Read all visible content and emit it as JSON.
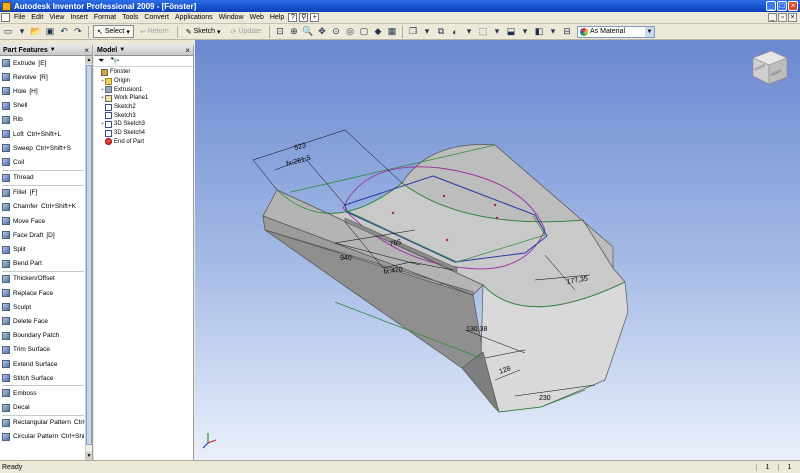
{
  "window": {
    "title": "Autodesk Inventor Professional 2009 - [Fönster]"
  },
  "menu": [
    "File",
    "Edit",
    "View",
    "Insert",
    "Format",
    "Tools",
    "Convert",
    "Applications",
    "Window",
    "Web",
    "Help"
  ],
  "toolbar": {
    "select": "Select",
    "return": "Return",
    "sketch": "Sketch",
    "update": "Update",
    "material": "As Material"
  },
  "features_panel": {
    "title": "Part Features",
    "items": [
      {
        "label": "Extrude",
        "shortcut": "[E]"
      },
      {
        "label": "Revolve",
        "shortcut": "[R]"
      },
      {
        "label": "Hole",
        "shortcut": "[H]"
      },
      {
        "label": "Shell",
        "shortcut": ""
      },
      {
        "label": "Rib",
        "shortcut": ""
      },
      {
        "label": "Loft",
        "shortcut": "Ctrl+Shift+L"
      },
      {
        "label": "Sweep",
        "shortcut": "Ctrl+Shift+S"
      },
      {
        "label": "Coil",
        "shortcut": ""
      },
      {
        "label": "Thread",
        "shortcut": ""
      },
      {
        "label": "Fillet",
        "shortcut": "[F]"
      },
      {
        "label": "Chamfer",
        "shortcut": "Ctrl+Shift+K"
      },
      {
        "label": "Move Face",
        "shortcut": ""
      },
      {
        "label": "Face Draft",
        "shortcut": "[D]"
      },
      {
        "label": "Split",
        "shortcut": ""
      },
      {
        "label": "Bend Part",
        "shortcut": ""
      },
      {
        "label": "Thicken/Offset",
        "shortcut": ""
      },
      {
        "label": "Replace Face",
        "shortcut": ""
      },
      {
        "label": "Sculpt",
        "shortcut": ""
      },
      {
        "label": "Delete Face",
        "shortcut": ""
      },
      {
        "label": "Boundary Patch",
        "shortcut": ""
      },
      {
        "label": "Trim Surface",
        "shortcut": ""
      },
      {
        "label": "Extend Surface",
        "shortcut": ""
      },
      {
        "label": "Stitch Surface",
        "shortcut": ""
      },
      {
        "label": "Emboss",
        "shortcut": ""
      },
      {
        "label": "Decal",
        "shortcut": ""
      },
      {
        "label": "Rectangular Pattern",
        "shortcut": "Ctrl+Shift+R"
      },
      {
        "label": "Circular Pattern",
        "shortcut": "Ctrl+Shift+O"
      }
    ]
  },
  "model_panel": {
    "title": "Model",
    "tree": [
      {
        "label": "Fönster",
        "level": 0,
        "icon": "part",
        "expander": ""
      },
      {
        "label": "Origin",
        "level": 1,
        "icon": "folder",
        "expander": "+"
      },
      {
        "label": "Extrusion1",
        "level": 1,
        "icon": "extr",
        "expander": "+"
      },
      {
        "label": "Work Plane1",
        "level": 1,
        "icon": "plane",
        "expander": "+"
      },
      {
        "label": "Sketch2",
        "level": 1,
        "icon": "sketch",
        "expander": ""
      },
      {
        "label": "Sketch3",
        "level": 1,
        "icon": "sketch",
        "expander": ""
      },
      {
        "label": "3D Sketch3",
        "level": 1,
        "icon": "sketch",
        "expander": "+"
      },
      {
        "label": "3D Sketch4",
        "level": 1,
        "icon": "sketch",
        "expander": ""
      },
      {
        "label": "End of Part",
        "level": 1,
        "icon": "end",
        "expander": ""
      }
    ]
  },
  "viewcube": {
    "front": "FRONT",
    "right": "RIGHT"
  },
  "dimensions": [
    "523",
    "fx:261,5",
    "765",
    "940",
    "fx:470",
    "177,35",
    "130,38",
    "128",
    "230"
  ],
  "status": {
    "text": "Ready",
    "count1": "1",
    "count2": "1"
  }
}
